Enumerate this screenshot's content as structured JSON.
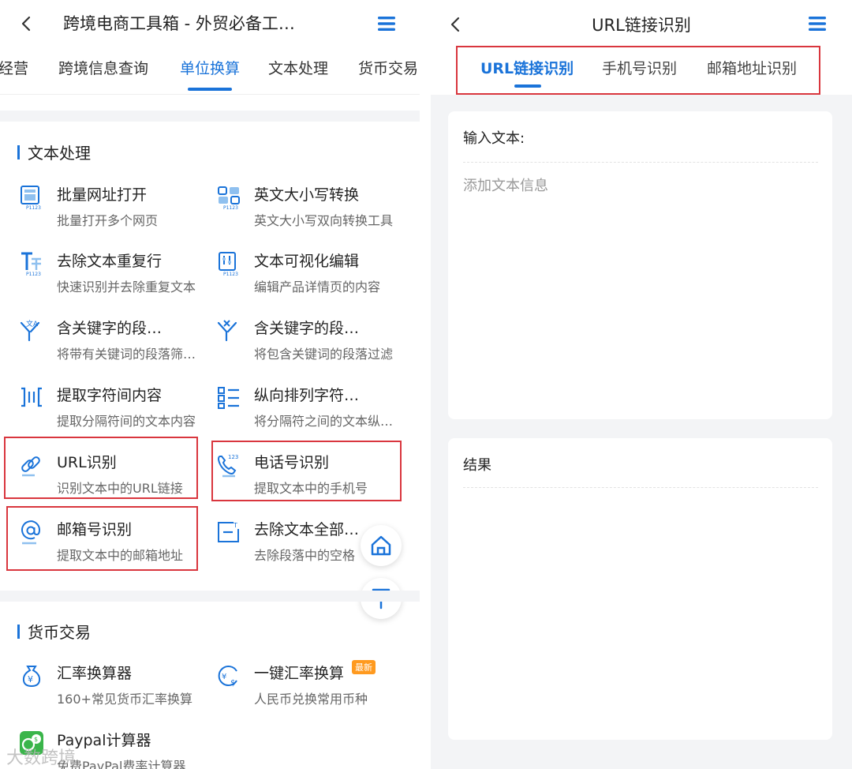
{
  "left": {
    "title": "跨境电商工具箱 - 外贸必备工…",
    "tabs": [
      {
        "label": "经营"
      },
      {
        "label": "跨境信息查询"
      },
      {
        "label": "单位换算",
        "active": true
      },
      {
        "label": "文本处理"
      },
      {
        "label": "货币交易"
      }
    ],
    "text_section": {
      "title": "文本处理",
      "tools": [
        {
          "name": "批量网址打开",
          "desc": "批量打开多个网页",
          "icon": "batch-url-icon"
        },
        {
          "name": "英文大小写转换",
          "desc": "英文大小写双向转换工具",
          "icon": "case-convert-icon"
        },
        {
          "name": "去除文本重复行",
          "desc": "快速识别并去除重复文本",
          "icon": "dedupe-text-icon"
        },
        {
          "name": "文本可视化编辑",
          "desc": "编辑产品详情页的内容",
          "icon": "visual-edit-icon"
        },
        {
          "name": "含关键字的段…",
          "desc": "将带有关键词的段落筛…",
          "icon": "filter-keyword-icon"
        },
        {
          "name": "含关键字的段…",
          "desc": "将包含关键词的段落过滤",
          "icon": "remove-keyword-icon"
        },
        {
          "name": "提取字符间内容",
          "desc": "提取分隔符间的文本内容",
          "icon": "extract-between-icon"
        },
        {
          "name": "纵向排列字符…",
          "desc": "将分隔符之间的文本纵…",
          "icon": "vertical-list-icon"
        },
        {
          "name": "URL识别",
          "desc": "识别文本中的URL链接",
          "icon": "link-icon"
        },
        {
          "name": "电话号识别",
          "desc": "提取文本中的手机号",
          "icon": "phone-icon"
        },
        {
          "name": "邮箱号识别",
          "desc": "提取文本中的邮箱地址",
          "icon": "at-icon"
        },
        {
          "name": "去除文本全部…",
          "desc": "去除段落中的空格",
          "icon": "remove-space-icon"
        }
      ]
    },
    "currency_section": {
      "title": "货币交易",
      "tools": [
        {
          "name": "汇率换算器",
          "desc": "160+常见货币汇率换算",
          "icon": "money-bag-icon"
        },
        {
          "name": "一键汇率换算",
          "desc": "人民币兑换常用币种",
          "icon": "currency-exchange-icon",
          "badge": "最新"
        },
        {
          "name": "Paypal计算器",
          "desc": "免费PayPal费率计算器",
          "icon": "paypal-calc-icon"
        }
      ]
    },
    "watermark": "大数跨境"
  },
  "right": {
    "title": "URL链接识别",
    "tabs": [
      {
        "label": "URL链接识别",
        "active": true
      },
      {
        "label": "手机号识别"
      },
      {
        "label": "邮箱地址识别"
      }
    ],
    "input_card": {
      "label": "输入文本:",
      "placeholder": "添加文本信息",
      "value": ""
    },
    "result_card": {
      "label": "结果"
    }
  },
  "colors": {
    "accent": "#1a73d9",
    "highlight_box": "#d9363e",
    "badge": "#ff9a1f",
    "background": "#f3f4f6"
  }
}
